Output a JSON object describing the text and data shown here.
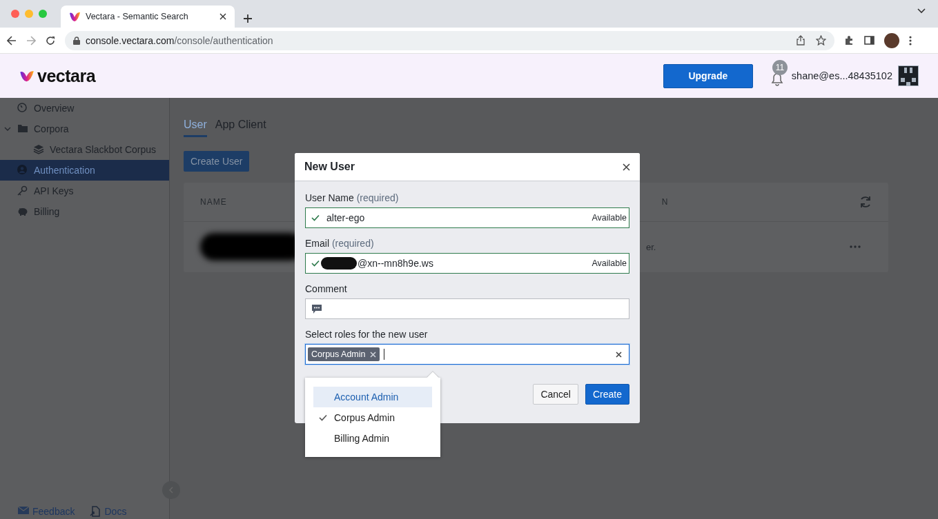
{
  "browser": {
    "tabs": [
      {
        "title": "Vectara - Semantic Search",
        "selected": true
      }
    ],
    "url": {
      "host": "console.vectara.com",
      "path": "/console/authentication"
    }
  },
  "header": {
    "logo": "vectara",
    "upgrade_button": "Upgrade",
    "notifications": "11",
    "account": "shane@es...48435102"
  },
  "sidebar": {
    "items": [
      {
        "label": "Overview",
        "selected": false
      },
      {
        "label": "Corpora",
        "selected": false,
        "expanded": true,
        "children": [
          {
            "label": "Vectara Slackbot Corpus",
            "selected": false
          }
        ]
      },
      {
        "label": "Authentication",
        "selected": true
      },
      {
        "label": "API Keys",
        "selected": false
      },
      {
        "label": "Billing",
        "selected": false
      }
    ],
    "footer_links": [
      {
        "label": "Feedback"
      },
      {
        "label": "Docs"
      }
    ]
  },
  "main": {
    "tabs": [
      {
        "label": "User",
        "selected": true
      },
      {
        "label": "App Client",
        "selected": false
      }
    ],
    "create_button": "Create User",
    "table": {
      "columns": [
        "NAME",
        "N"
      ],
      "rows": [
        {
          "column_2": "er."
        }
      ]
    }
  },
  "dialog": {
    "title": "New User",
    "fields": [
      {
        "kind": "text",
        "label": "User Name",
        "hint": "(required)",
        "value": "alter-ego",
        "status": "Available",
        "valid": true,
        "redacted": false
      },
      {
        "kind": "text",
        "label": "Email",
        "hint": "(required)",
        "value": "@xn--mn8h9e.ws",
        "status": "Available",
        "valid": true,
        "redacted": true
      },
      {
        "kind": "comment",
        "label": "Comment"
      },
      {
        "kind": "tags",
        "label": "Select roles for the new user",
        "tags": [
          "Corpus Admin"
        ],
        "focused": true
      }
    ],
    "dropdown": [
      {
        "label": "Account Admin",
        "checked": false,
        "highlighted": true
      },
      {
        "label": "Corpus Admin",
        "checked": true,
        "highlighted": false
      },
      {
        "label": "Billing Admin",
        "checked": false,
        "highlighted": false
      }
    ],
    "buttons": [
      {
        "label": "Cancel",
        "kind": "secondary"
      },
      {
        "label": "Create",
        "kind": "primary"
      }
    ]
  }
}
